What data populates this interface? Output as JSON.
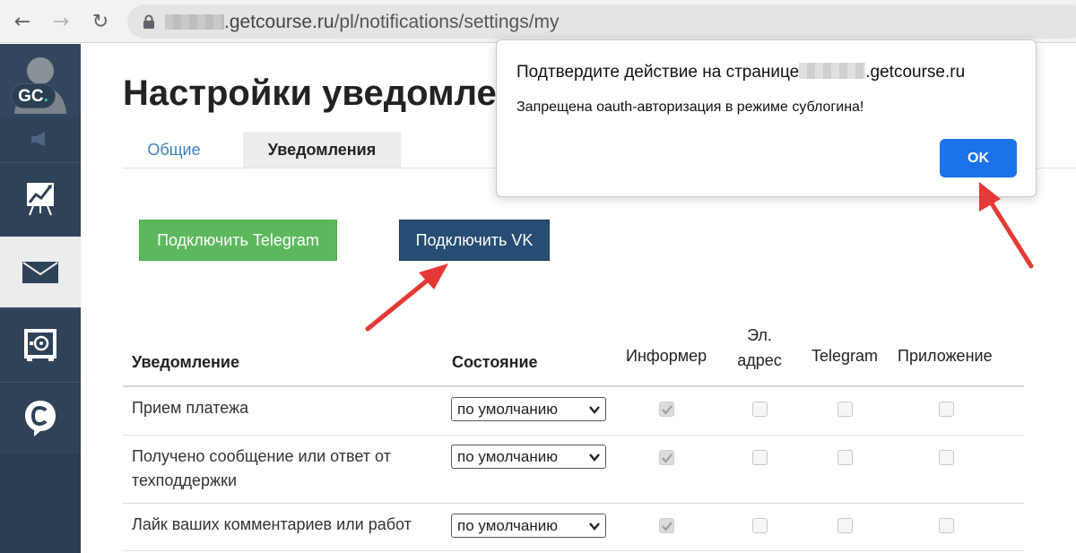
{
  "browser": {
    "url_domain": ".getcourse.ru",
    "url_path": "/pl/notifications/settings/my"
  },
  "sidebar": {
    "badge_text": "GC",
    "badge_dot": ".",
    "items": [
      "speaker-icon",
      "chart-icon",
      "mail-icon",
      "safe-icon",
      "chat-icon"
    ]
  },
  "page": {
    "title": "Настройки уведомлен",
    "tabs": [
      {
        "label": "Общие",
        "active": false
      },
      {
        "label": "Уведомления",
        "active": true
      }
    ],
    "buttons": {
      "telegram": "Подключить Telegram",
      "vk": "Подключить VK"
    }
  },
  "table": {
    "headers": {
      "notification": "Уведомление",
      "state": "Состояние",
      "informer": "Информер",
      "email_line1": "Эл.",
      "email_line2": "адрес",
      "telegram": "Telegram",
      "app": "Приложение"
    },
    "rows": [
      {
        "label": "Прием платежа",
        "state": "по умолчанию",
        "informer": true,
        "email": false,
        "telegram": false,
        "app": false
      },
      {
        "label_line1": "Получено сообщение или ответ от",
        "label_line2": "техподдержки",
        "state": "по умолчанию",
        "informer": true,
        "email": false,
        "telegram": false,
        "app": false
      },
      {
        "label": "Лайк ваших комментариев или работ",
        "state": "по умолчанию",
        "informer": true,
        "email": false,
        "telegram": false,
        "app": false
      }
    ]
  },
  "dialog": {
    "title_prefix": "Подтвердите действие на странице",
    "title_suffix": ".getcourse.ru",
    "message": "Запрещена oauth-авторизация в режиме сублогина!",
    "ok_label": "OK"
  },
  "colors": {
    "sidebar": "#2e4258",
    "telegram_button": "#5cb85c",
    "vk_button": "#264d73",
    "ok_button": "#1a73e8",
    "arrow": "#e53935",
    "tab_link": "#3b7fbf"
  }
}
